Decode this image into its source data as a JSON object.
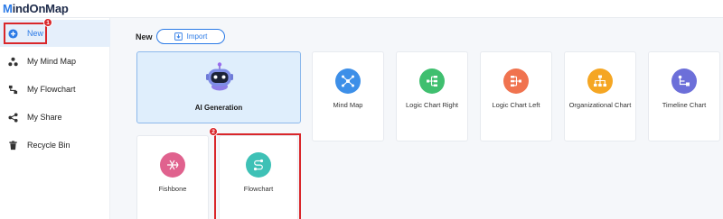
{
  "app": {
    "logo_prefix": "M",
    "logo_rest": "indOnMap"
  },
  "sidebar": {
    "items": [
      {
        "label": "New",
        "icon": "plus-circle-icon"
      },
      {
        "label": "My Mind Map",
        "icon": "mind-map-icon"
      },
      {
        "label": "My Flowchart",
        "icon": "flowchart-icon"
      },
      {
        "label": "My Share",
        "icon": "share-icon"
      },
      {
        "label": "Recycle Bin",
        "icon": "trash-icon"
      }
    ]
  },
  "main": {
    "section_title": "New",
    "import_label": "Import",
    "cards": [
      {
        "label": "AI Generation",
        "icon": "robot-icon"
      },
      {
        "label": "Mind Map",
        "icon": "mind-map-icon",
        "color": "#3d8fe8"
      },
      {
        "label": "Logic Chart Right",
        "icon": "logic-right-icon",
        "color": "#3fbf6f"
      },
      {
        "label": "Logic Chart Left",
        "icon": "logic-left-icon",
        "color": "#f0734f"
      },
      {
        "label": "Organizational Chart",
        "icon": "org-chart-icon",
        "color": "#f5a623"
      },
      {
        "label": "Timeline Chart",
        "icon": "timeline-icon",
        "color": "#6c6fd9"
      },
      {
        "label": "Fishbone",
        "icon": "fishbone-icon",
        "color": "#e0628e"
      },
      {
        "label": "Flowchart",
        "icon": "flowchart-icon",
        "color": "#3ec1b6"
      }
    ]
  },
  "annotations": {
    "step1": "1",
    "step2": "2",
    "accent": "#d9262a"
  }
}
